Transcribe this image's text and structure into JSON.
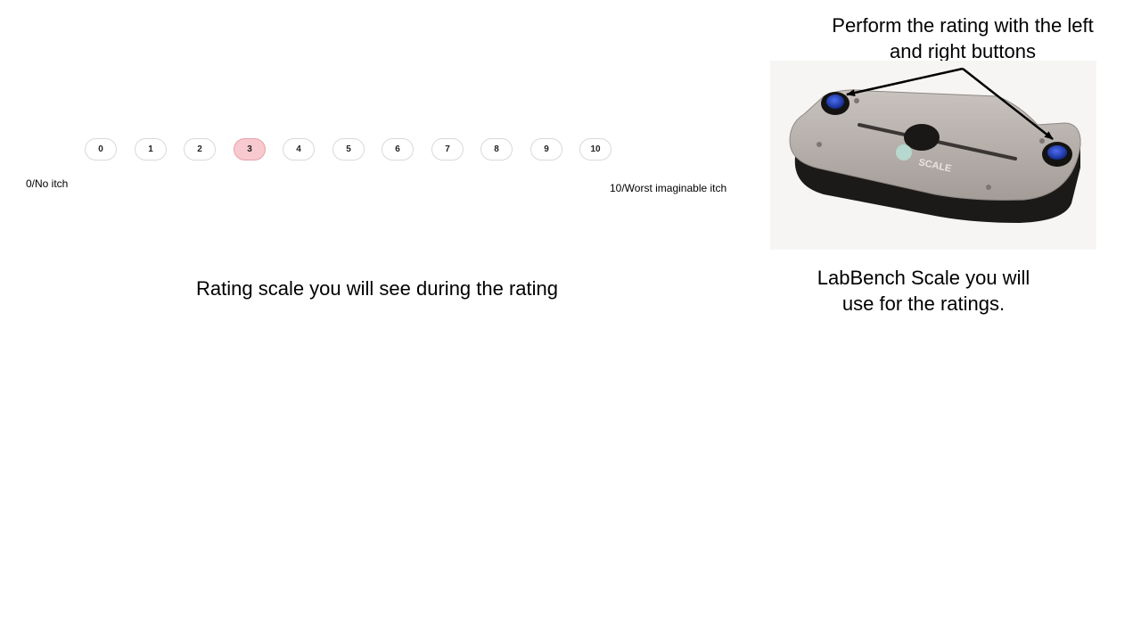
{
  "rating_scale": {
    "options": [
      "0",
      "1",
      "2",
      "3",
      "4",
      "5",
      "6",
      "7",
      "8",
      "9",
      "10"
    ],
    "selected": "3",
    "low_anchor": "0/No  itch",
    "high_anchor": "10/Worst imaginable itch",
    "caption": "Rating scale you will see during the rating"
  },
  "device": {
    "instruction": "Perform the rating with the left and right buttons",
    "caption": "LabBench Scale you will use for the ratings.",
    "logo_text": "SCALE",
    "button_color": "#1f3fb4"
  },
  "colors": {
    "selected_fill": "#f8c9cf",
    "pill_border": "#d9d9d9"
  }
}
